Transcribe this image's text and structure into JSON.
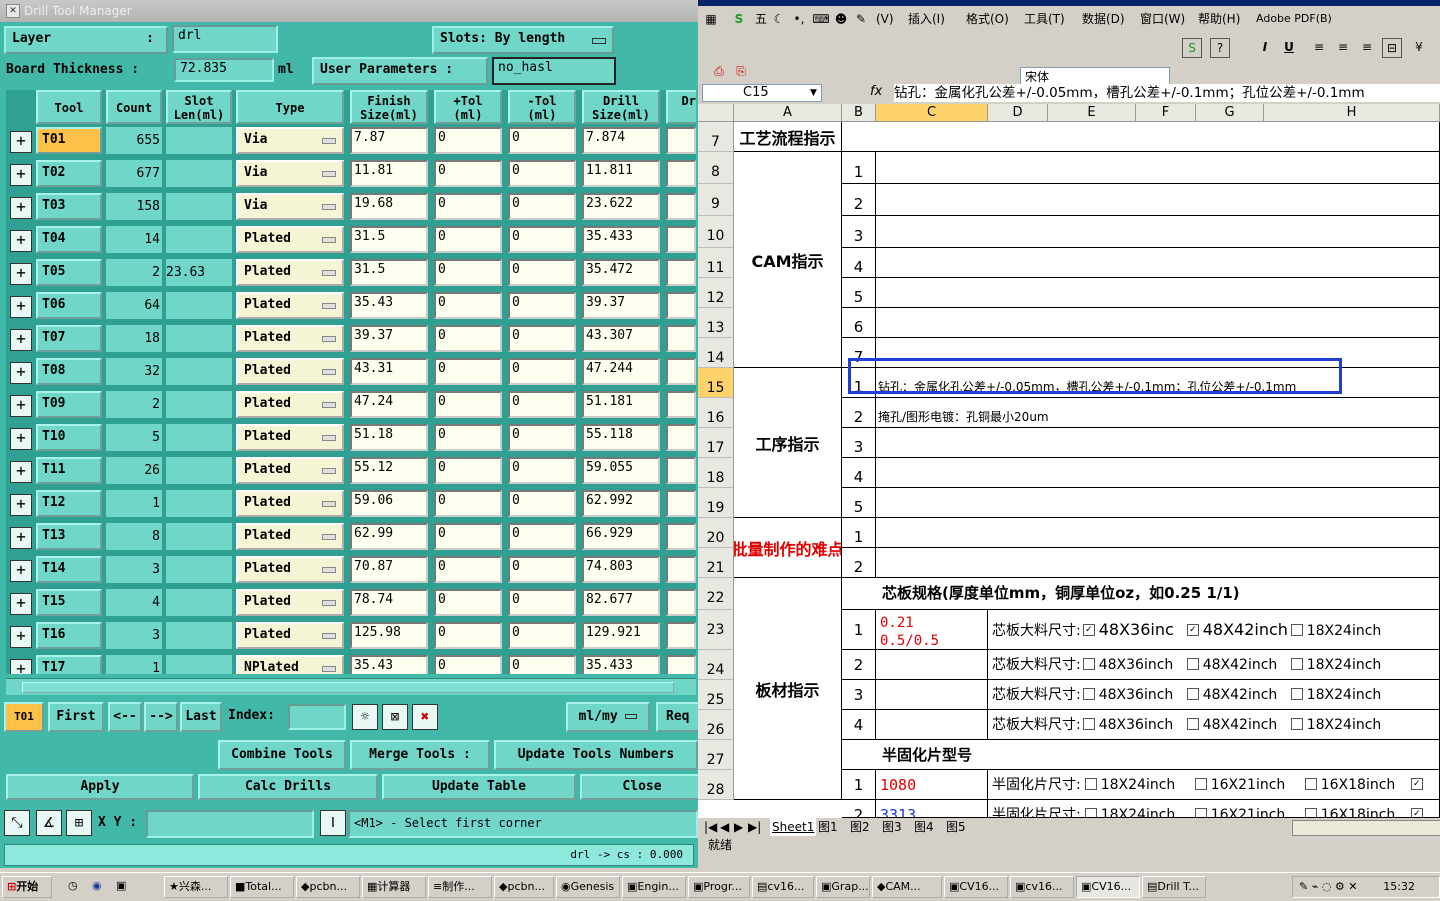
{
  "dtm": {
    "title": "Drill Tool Manager",
    "layer_label": "Layer",
    "layer_colon": ":",
    "layer_value": "drl",
    "slots_label": "Slots:",
    "slots_value": "By length",
    "board_thickness_label": "Board Thickness :",
    "board_thickness_value": "72.835",
    "board_thickness_unit": "ml",
    "user_params_label": "User Parameters :",
    "user_params_value": "no_hasl",
    "headers": [
      "Tool",
      "Count",
      "Slot Len(ml)",
      "Type",
      "Finish Size(ml)",
      "+Tol (ml)",
      "-Tol (ml)",
      "Drill Size(ml)",
      "Dr I"
    ],
    "rows": [
      {
        "tool": "T01",
        "count": "655",
        "slot": "",
        "type": "Via",
        "finish": "7.87",
        "ptol": "0",
        "ntol": "0",
        "drill": "7.874"
      },
      {
        "tool": "T02",
        "count": "677",
        "slot": "",
        "type": "Via",
        "finish": "11.81",
        "ptol": "0",
        "ntol": "0",
        "drill": "11.811"
      },
      {
        "tool": "T03",
        "count": "158",
        "slot": "",
        "type": "Via",
        "finish": "19.68",
        "ptol": "0",
        "ntol": "0",
        "drill": "23.622"
      },
      {
        "tool": "T04",
        "count": "14",
        "slot": "",
        "type": "Plated",
        "finish": "31.5",
        "ptol": "0",
        "ntol": "0",
        "drill": "35.433"
      },
      {
        "tool": "T05",
        "count": "2",
        "slot": "23.63",
        "type": "Plated",
        "finish": "31.5",
        "ptol": "0",
        "ntol": "0",
        "drill": "35.472"
      },
      {
        "tool": "T06",
        "count": "64",
        "slot": "",
        "type": "Plated",
        "finish": "35.43",
        "ptol": "0",
        "ntol": "0",
        "drill": "39.37"
      },
      {
        "tool": "T07",
        "count": "18",
        "slot": "",
        "type": "Plated",
        "finish": "39.37",
        "ptol": "0",
        "ntol": "0",
        "drill": "43.307"
      },
      {
        "tool": "T08",
        "count": "32",
        "slot": "",
        "type": "Plated",
        "finish": "43.31",
        "ptol": "0",
        "ntol": "0",
        "drill": "47.244"
      },
      {
        "tool": "T09",
        "count": "2",
        "slot": "",
        "type": "Plated",
        "finish": "47.24",
        "ptol": "0",
        "ntol": "0",
        "drill": "51.181"
      },
      {
        "tool": "T10",
        "count": "5",
        "slot": "",
        "type": "Plated",
        "finish": "51.18",
        "ptol": "0",
        "ntol": "0",
        "drill": "55.118"
      },
      {
        "tool": "T11",
        "count": "26",
        "slot": "",
        "type": "Plated",
        "finish": "55.12",
        "ptol": "0",
        "ntol": "0",
        "drill": "59.055"
      },
      {
        "tool": "T12",
        "count": "1",
        "slot": "",
        "type": "Plated",
        "finish": "59.06",
        "ptol": "0",
        "ntol": "0",
        "drill": "62.992"
      },
      {
        "tool": "T13",
        "count": "8",
        "slot": "",
        "type": "Plated",
        "finish": "62.99",
        "ptol": "0",
        "ntol": "0",
        "drill": "66.929"
      },
      {
        "tool": "T14",
        "count": "3",
        "slot": "",
        "type": "Plated",
        "finish": "70.87",
        "ptol": "0",
        "ntol": "0",
        "drill": "74.803"
      },
      {
        "tool": "T15",
        "count": "4",
        "slot": "",
        "type": "Plated",
        "finish": "78.74",
        "ptol": "0",
        "ntol": "0",
        "drill": "82.677"
      },
      {
        "tool": "T16",
        "count": "3",
        "slot": "",
        "type": "Plated",
        "finish": "125.98",
        "ptol": "0",
        "ntol": "0",
        "drill": "129.921"
      },
      {
        "tool": "T17",
        "count": "1",
        "slot": "",
        "type": "NPlated",
        "finish": "35.43",
        "ptol": "0",
        "ntol": "0",
        "drill": "35.433"
      }
    ],
    "nav": {
      "current": "T01",
      "first": "First",
      "prev": "<--",
      "next": "-->",
      "last": "Last",
      "index_label": "Index:",
      "unit": "ml/my",
      "req": "Req"
    },
    "actions": {
      "combine": "Combine Tools",
      "merge": "Merge Tools :",
      "update_numbers": "Update Tools Numbers",
      "apply": "Apply",
      "calc": "Calc Drills",
      "update_table": "Update Table",
      "close": "Close"
    },
    "cmd": {
      "xy_label": "X Y :",
      "xy_value": "",
      "message": "<M1> - Select first corner",
      "status": "drl -> cs : 0.000"
    }
  },
  "excel": {
    "menu": [
      "(V)",
      "插入(I)",
      "格式(O)",
      "工具(T)",
      "数据(D)",
      "窗口(W)",
      "帮助(H)",
      "Adobe PDF(B)"
    ],
    "font": "宋体",
    "namebox": "C15",
    "formula": "钻孔：金属化孔公差+/-0.05mm，槽孔公差+/-0.1mm；孔位公差+/-0.1mm",
    "columns": [
      "A",
      "B",
      "C",
      "D",
      "E",
      "F",
      "G",
      "H"
    ],
    "row_numbers": [
      "7",
      "8",
      "9",
      "10",
      "11",
      "12",
      "13",
      "14",
      "15",
      "16",
      "17",
      "18",
      "19",
      "20",
      "21",
      "22",
      "23",
      "24",
      "25",
      "26",
      "27",
      "28"
    ],
    "sec_process": "工艺流程指示",
    "sec_cam": "CAM指示",
    "sec_procedure": "工序指示",
    "sec_difficulty": "不可批量制作的难点项目",
    "sec_board": "板材指示",
    "b_nums": [
      "1",
      "2",
      "3",
      "4",
      "5",
      "6",
      "7",
      "1",
      "2",
      "3",
      "4",
      "5",
      "1",
      "2",
      "1",
      "2",
      "3",
      "4",
      "1",
      "2"
    ],
    "procedure_1": "钻孔：金属化孔公差+/-0.05mm，槽孔公差+/-0.1mm；孔位公差+/-0.1mm",
    "procedure_2": "掩孔/图形电镀：孔铜最小20um",
    "core_header": "芯板规格(厚度单位mm，铜厚单位oz，如0.25 1/1)",
    "core_spec_1": "0.21",
    "core_spec_2": "0.5/0.5",
    "core_label": "芯板大料尺寸:",
    "sizes": [
      "48X36inch",
      "48X42inch",
      "18X24inch"
    ],
    "core_row1_sizes": [
      "48X36inc",
      "48X42inch",
      "18X24inch"
    ],
    "prepreg_header": "半固化片型号",
    "prepreg_1": "1080",
    "prepreg_2": "3313",
    "prepreg_label": "半固化片尺寸:",
    "prepreg_sizes": [
      "18X24inch",
      "16X21inch",
      "16X18inch"
    ],
    "tabs": [
      "Sheet1",
      "图1",
      "图2",
      "图3",
      "图4",
      "图5"
    ],
    "status": "就绪"
  },
  "taskbar": {
    "start": "开始",
    "items": [
      "兴森...",
      "Total...",
      "pcbn...",
      "计算器",
      "制作...",
      "pcbn...",
      "Genesis",
      "Engin...",
      "Progr...",
      "cv16...",
      "Grap...",
      "CAM...",
      "CV16...",
      "cv16...",
      "CV16...",
      "Drill T..."
    ],
    "clock": "15:32"
  }
}
